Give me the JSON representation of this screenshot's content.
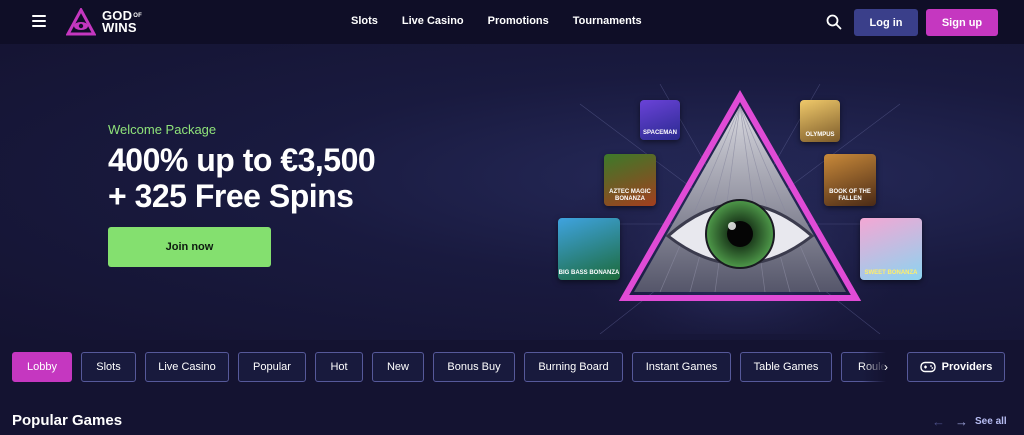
{
  "header": {
    "logo_line1": "GOD",
    "logo_sup": "OF",
    "logo_line2": "WINS",
    "nav": [
      "Slots",
      "Live Casino",
      "Promotions",
      "Tournaments"
    ],
    "login_label": "Log in",
    "signup_label": "Sign up"
  },
  "hero": {
    "eyebrow": "Welcome Package",
    "headline_line1": "400% up to €3,500",
    "headline_line2": "+ 325 Free Spins",
    "cta_label": "Join now",
    "game_tiles": [
      "SPACEMAN",
      "OLYMPUS",
      "AZTEC MAGIC BONANZA",
      "BOOK OF THE FALLEN",
      "BIG BASS BONANZA",
      "SWEET BONANZA"
    ]
  },
  "categories": {
    "items": [
      "Lobby",
      "Slots",
      "Live Casino",
      "Popular",
      "Hot",
      "New",
      "Bonus Buy",
      "Burning Board",
      "Instant Games",
      "Table Games",
      "Roulette"
    ],
    "active": "Lobby",
    "providers_label": "Providers"
  },
  "popular": {
    "title": "Popular Games",
    "see_all_label": "See all"
  },
  "colors": {
    "accent_pink": "#c537c0",
    "accent_green": "#84e06f",
    "login_blue": "#3a3f8a"
  }
}
